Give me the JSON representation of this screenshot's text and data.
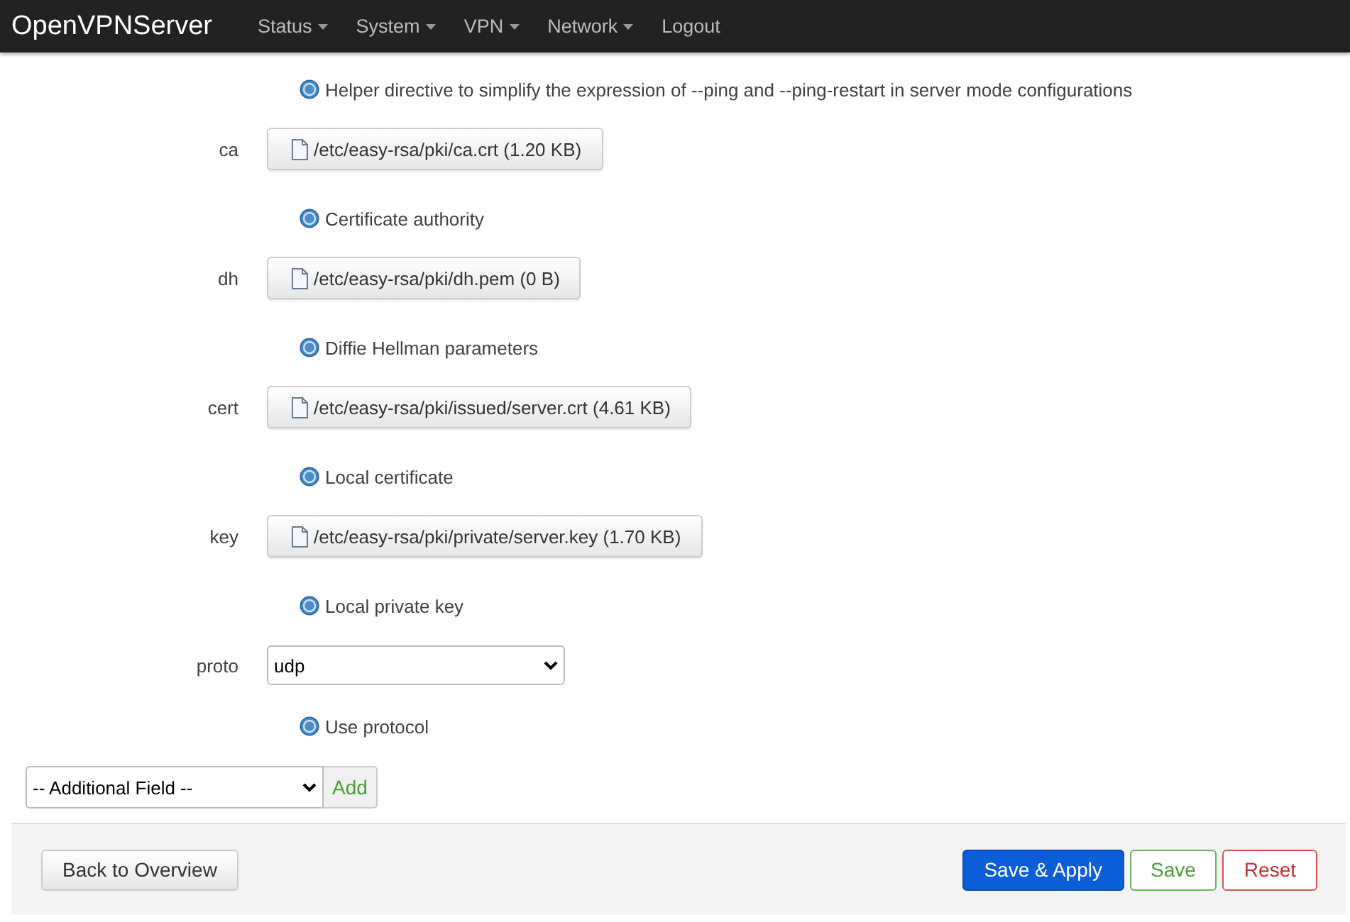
{
  "navbar": {
    "brand": "OpenVPNServer",
    "items": [
      {
        "label": "Status",
        "dropdown": true
      },
      {
        "label": "System",
        "dropdown": true
      },
      {
        "label": "VPN",
        "dropdown": true
      },
      {
        "label": "Network",
        "dropdown": true
      },
      {
        "label": "Logout",
        "dropdown": false
      }
    ]
  },
  "top_help": "Helper directive to simplify the expression of --ping and --ping-restart in server mode configurations",
  "fields": [
    {
      "label": "ca",
      "kind": "file",
      "value": "/etc/easy-rsa/pki/ca.crt (1.20 KB)",
      "help": "Certificate authority"
    },
    {
      "label": "dh",
      "kind": "file",
      "value": "/etc/easy-rsa/pki/dh.pem (0 B)",
      "help": "Diffie Hellman parameters"
    },
    {
      "label": "cert",
      "kind": "file",
      "value": "/etc/easy-rsa/pki/issued/server.crt (4.61 KB)",
      "help": "Local certificate"
    },
    {
      "label": "key",
      "kind": "file",
      "value": "/etc/easy-rsa/pki/private/server.key (1.70 KB)",
      "help": "Local private key"
    },
    {
      "label": "proto",
      "kind": "select",
      "value": "udp",
      "help": "Use protocol"
    }
  ],
  "additional": {
    "value": "-- Additional Field --",
    "button": "Add"
  },
  "footer": {
    "back": "Back to Overview",
    "actions": [
      {
        "label": "Save & Apply",
        "kind": "primary"
      },
      {
        "label": "Save",
        "kind": "positive"
      },
      {
        "label": "Reset",
        "kind": "negative"
      }
    ]
  }
}
